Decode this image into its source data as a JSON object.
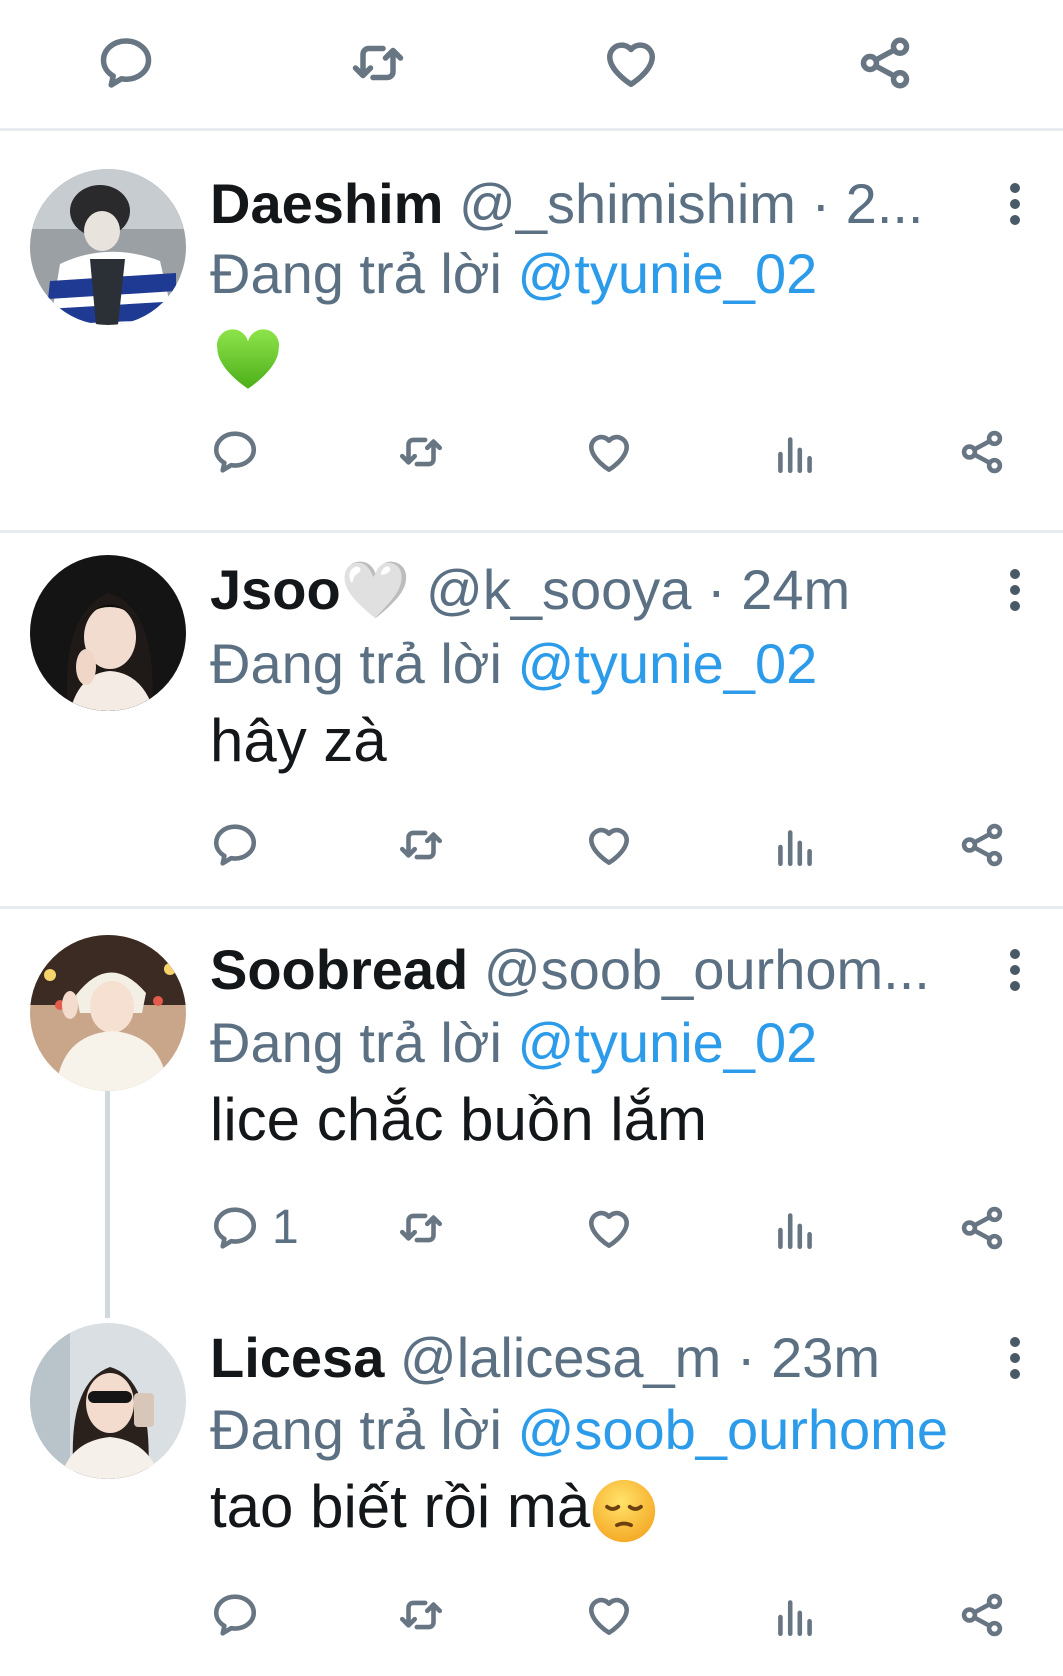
{
  "icons": {
    "reply": "speech-bubble-icon",
    "retweet": "retweet-arrows-icon",
    "like": "heart-outline-icon",
    "analytics": "bar-chart-icon",
    "share": "share-nodes-icon",
    "more": "three-dots-vertical-icon"
  },
  "colors": {
    "mention": "#2b9bea",
    "icon": "#687684",
    "divider": "#e6ecf0"
  },
  "replies": [
    {
      "name": "Daeshim",
      "handle_time": "@_shimishim · 2...",
      "replying_prefix": "Đang trả lời",
      "replying_to": "@tyunie_02",
      "text": "",
      "emoji": "💚"
    },
    {
      "name": "Jsoo",
      "name_emoji": "🤍",
      "handle_time": "@k_sooya · 24m",
      "replying_prefix": "Đang trả lời",
      "replying_to": "@tyunie_02",
      "text": "hây zà"
    },
    {
      "name": "Soobread",
      "handle_time": "@soob_ourhom...",
      "replying_prefix": "Đang trả lời",
      "replying_to": "@tyunie_02",
      "text": "lice chắc buồn lắm",
      "reply_count": "1"
    },
    {
      "name": "Licesa",
      "handle_time": "@lalicesa_m · 23m",
      "replying_prefix": "Đang trả lời",
      "replying_to": "@soob_ourhome",
      "text": "tao biết rồi mà",
      "emoji": "😔"
    }
  ]
}
